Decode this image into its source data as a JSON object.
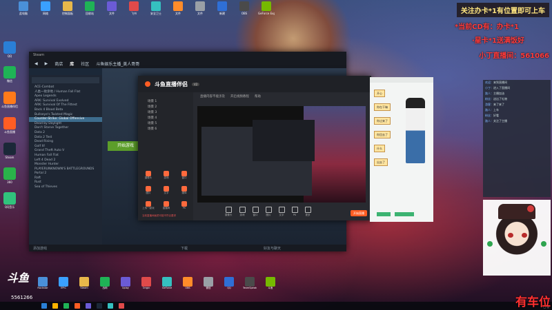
{
  "overlay": {
    "top_banner": "关注办卡*1有位置即可上车",
    "red_lines": [
      "*当前CD有：办卡*1",
      "·星卡*1送满饭好",
      "小丁直播间：561066"
    ],
    "corner": "有车位"
  },
  "desktop_icons": [
    "此电脑",
    "网络",
    "控制面板",
    "回收站",
    "文件",
    "飞书",
    "安全卫士",
    "文件",
    "文件",
    "新建",
    "OBS",
    "GeForce Experience"
  ],
  "left_icons": [
    "QQ",
    "微信",
    "斗鱼直播伴侣",
    "斗鱼直播",
    "Steam",
    "360",
    "QQ音乐"
  ],
  "steam": {
    "nav": [
      "商店",
      "库",
      "社区",
      "斗鱼娱乐主播_美人哥哥"
    ],
    "games": [
      "ACE-Combat",
      "人类一败涂地 / Human Fall Flat",
      "Apex Legends",
      "ARK: Survival Evolved",
      "ARK: Survival Of The Fittest",
      "Back 4 Blood Beta",
      "Bullseye's Twisted Magic",
      "Counter-Strike: Global Offensive",
      "Dead by Daylight",
      "Don't Starve Together",
      "Dota 2",
      "Dota 2 Test",
      "Dead Rising",
      "Golf It!",
      "Grand Theft Auto V",
      "Human Fall Flat",
      "Left 4 Dead 2",
      "Monster Hunter",
      "PLAYERUNKNOWN'S BATTLEGROUNDS",
      "Portal 2",
      "Raft",
      "Rust",
      "Sea of Thieves"
    ],
    "play_label": "开始游戏",
    "footer": [
      "添加游戏",
      "好友与聊天",
      "下载"
    ]
  },
  "douyu": {
    "logo": "斗鱼直播伴侣",
    "version": "V2",
    "tabs": [
      "直播内容不能涉及",
      "开启视频教程",
      "帮助"
    ],
    "scenes": [
      "场景 1",
      "场景 2",
      "场景 3",
      "场景 4",
      "场景 5",
      "场景 6"
    ],
    "tools": [
      {
        "label": "摄像头"
      },
      {
        "label": "游戏"
      },
      {
        "label": "窗口"
      },
      {
        "label": "图片"
      },
      {
        "label": "文字"
      },
      {
        "label": "PK"
      },
      {
        "label": "更多"
      }
    ],
    "scene_tools": [
      "摄像头",
      "游戏",
      "窗口",
      "图片",
      "文字",
      "媒体",
      "上传一起玩",
      "直播间",
      "PK"
    ],
    "live_button": "开始直播",
    "warning": "当前直播间画质可能不符合要求"
  },
  "chat": {
    "bubbles": [
      "开心",
      "你在干嘛",
      "你过来了",
      "你回去了",
      "什么",
      "出去了"
    ]
  },
  "danmu": [
    {
      "name": "欢迎",
      "text": "来到直播间"
    },
    {
      "name": "小丁",
      "text": "进入了直播间"
    },
    {
      "name": "路人",
      "text": "主播加油"
    },
    {
      "name": "粉丝",
      "text": "送出了礼物"
    },
    {
      "name": "游客",
      "text": "来了来了"
    },
    {
      "name": "路人",
      "text": "上车"
    },
    {
      "name": "粉丝",
      "text": "好看"
    },
    {
      "name": "路人",
      "text": "关注了主播"
    }
  ],
  "brand": {
    "logo": "斗鱼",
    "room": "5561266"
  },
  "taskbar_apps": [
    "Rockstar",
    "EPIC",
    "Steam",
    "战网",
    "Uplay",
    "Origin",
    "GeForce",
    "OBS",
    "微信",
    "QQ",
    "TeamSpeak",
    "斗鱼"
  ],
  "colors": {
    "accent": "#ff5d23",
    "steam_play": "#5c9e2a",
    "overlay_red": "#ff3b3b"
  }
}
